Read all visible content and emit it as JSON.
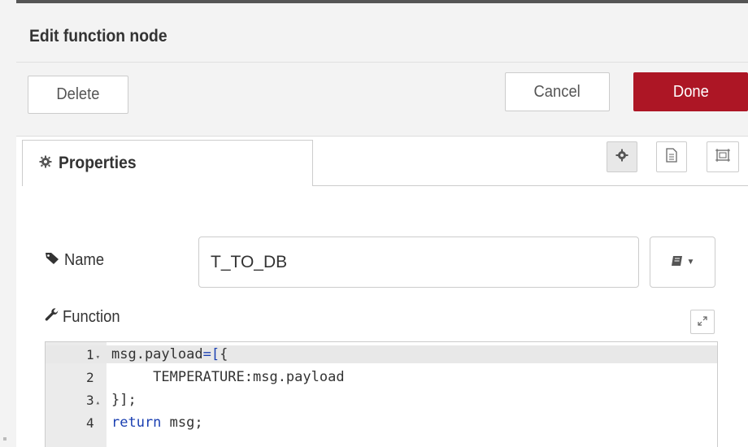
{
  "tray": {
    "title": "Edit function node",
    "buttons": {
      "delete": "Delete",
      "cancel": "Cancel",
      "done": "Done"
    }
  },
  "tabs": [
    {
      "label": "Properties",
      "icon": "gear-icon"
    }
  ],
  "toolbar_icons": [
    "gear-icon",
    "document-icon",
    "frame-icon"
  ],
  "form": {
    "name": {
      "label": "Name",
      "value": "T_TO_DB",
      "icon": "tag-icon"
    },
    "function": {
      "label": "Function",
      "icon": "wrench-icon"
    }
  },
  "editor": {
    "lines": [
      {
        "number": "1",
        "fold": "▾",
        "parts": [
          "msg.payload",
          "=[",
          "{"
        ]
      },
      {
        "number": "2",
        "fold": "",
        "text": "     TEMPERATURE:msg.payload"
      },
      {
        "number": "3",
        "fold": "▴",
        "text": "}];"
      },
      {
        "number": "4",
        "fold": "",
        "keyword": "return",
        "rest": " msg;"
      }
    ]
  },
  "colors": {
    "done_button": "#ad1625",
    "keyword": "#1b40b2"
  }
}
